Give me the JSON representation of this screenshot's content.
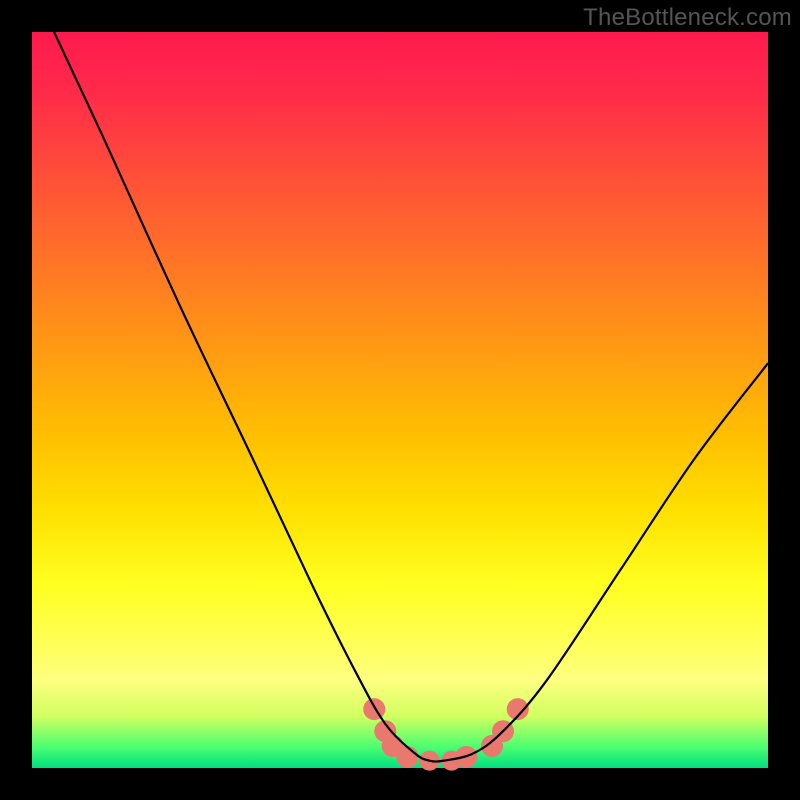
{
  "watermark": "TheBottleneck.com",
  "chart_data": {
    "type": "line",
    "title": "",
    "xlabel": "",
    "ylabel": "",
    "xlim": [
      0,
      100
    ],
    "ylim": [
      0,
      100
    ],
    "series": [
      {
        "name": "bottleneck-curve",
        "x": [
          3,
          10,
          20,
          30,
          38,
          44,
          48,
          52,
          54,
          56,
          60,
          64,
          70,
          80,
          90,
          100
        ],
        "values": [
          100,
          85,
          63,
          42,
          25,
          13,
          6,
          2,
          1,
          1,
          2,
          5,
          12,
          27,
          42,
          55
        ]
      }
    ],
    "markers": {
      "name": "highlight-dots",
      "color": "#e9786f",
      "x": [
        46.5,
        48,
        49,
        51,
        54,
        57,
        59,
        62.5,
        64,
        66
      ],
      "values": [
        8,
        5,
        3,
        1.5,
        1,
        1,
        1.5,
        3,
        5,
        8
      ],
      "radius": [
        11,
        11,
        11,
        11,
        10,
        10,
        11,
        11,
        11,
        11
      ]
    }
  }
}
